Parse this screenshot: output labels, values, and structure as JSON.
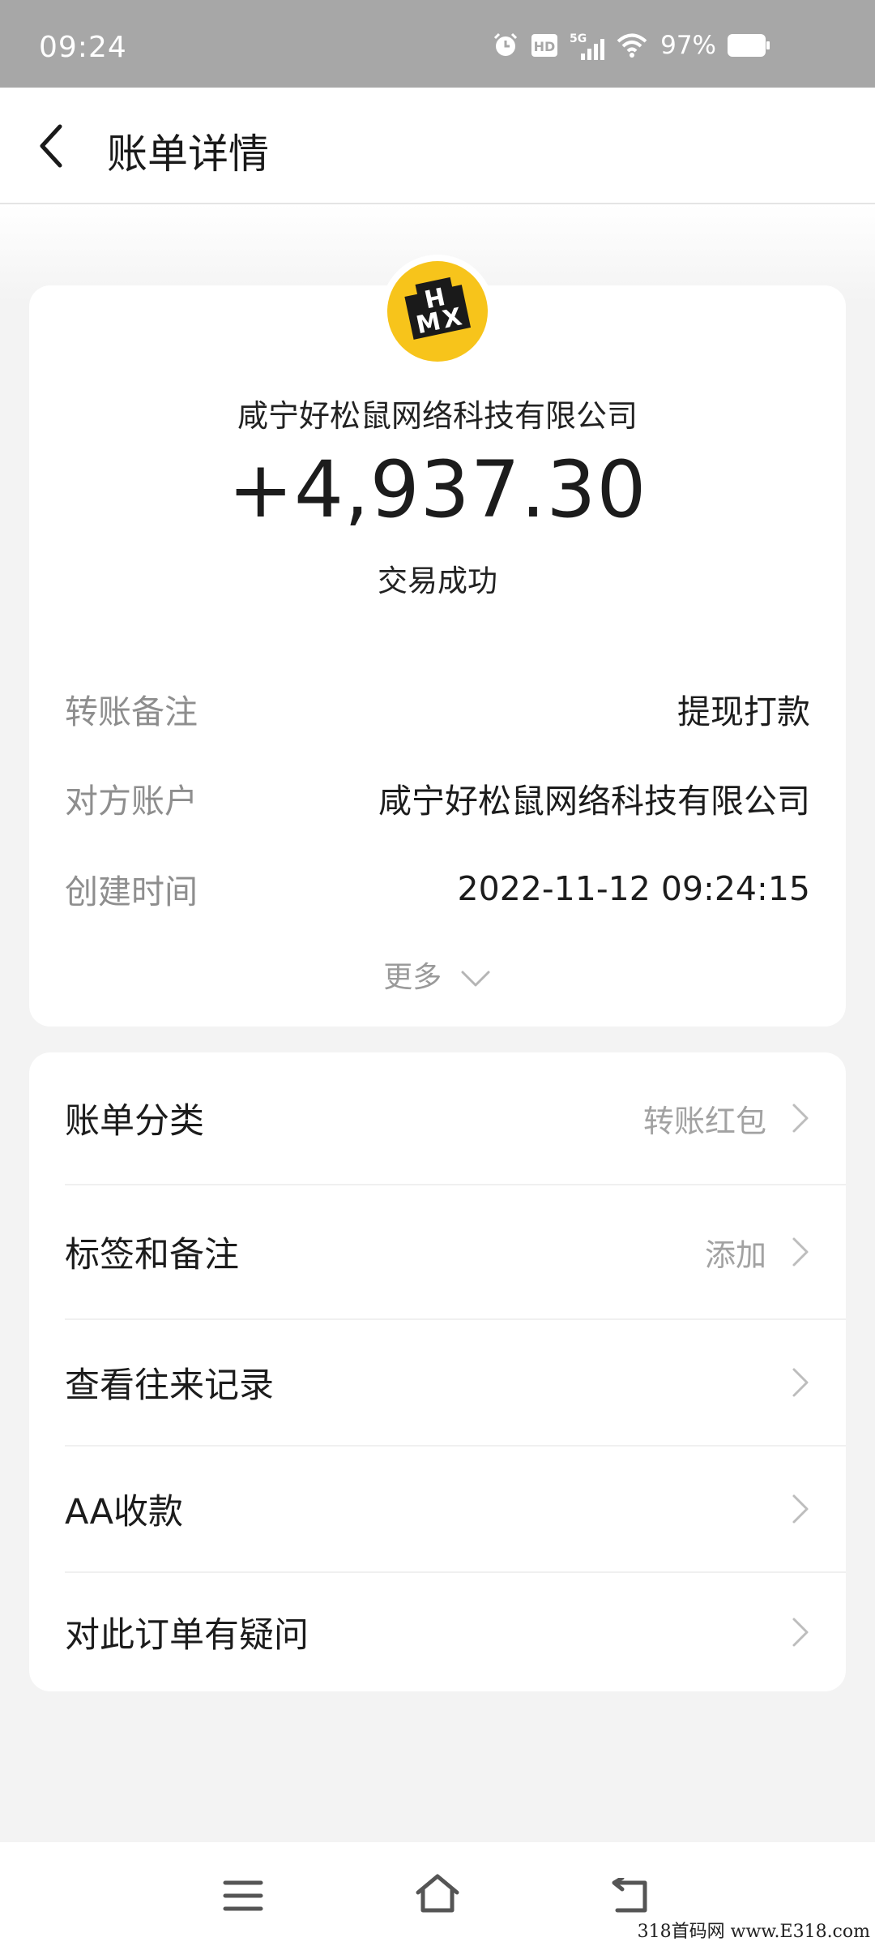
{
  "status_bar": {
    "time": "09:24",
    "battery": "97%",
    "icons": [
      "alarm-icon",
      "hd-icon",
      "5g-signal-icon",
      "wifi-icon",
      "battery-icon"
    ],
    "color": "#a7a7a7"
  },
  "header": {
    "back_icon": "chevron-left-icon",
    "title": "账单详情"
  },
  "bill": {
    "logo_text": "HMX",
    "logo_color": "#f7c41b",
    "merchant": "咸宁好松鼠网络科技有限公司",
    "amount": "+4,937.30",
    "status": "交易成功",
    "details": [
      {
        "key": "转账备注",
        "value": "提现打款"
      },
      {
        "key": "对方账户",
        "value": "咸宁好松鼠网络科技有限公司"
      },
      {
        "key": "创建时间",
        "value": "2022-11-12 09:24:15"
      }
    ],
    "more_label": "更多"
  },
  "menu": [
    {
      "label": "账单分类",
      "value": "转账红包"
    },
    {
      "label": "标签和备注",
      "value": "添加"
    },
    {
      "label": "查看往来记录",
      "value": ""
    },
    {
      "label": "AA收款",
      "value": ""
    },
    {
      "label": "对此订单有疑问",
      "value": ""
    }
  ],
  "system_nav": [
    "menu-icon",
    "home-icon",
    "back-icon"
  ],
  "watermark": "318首码网 www.E318.com"
}
